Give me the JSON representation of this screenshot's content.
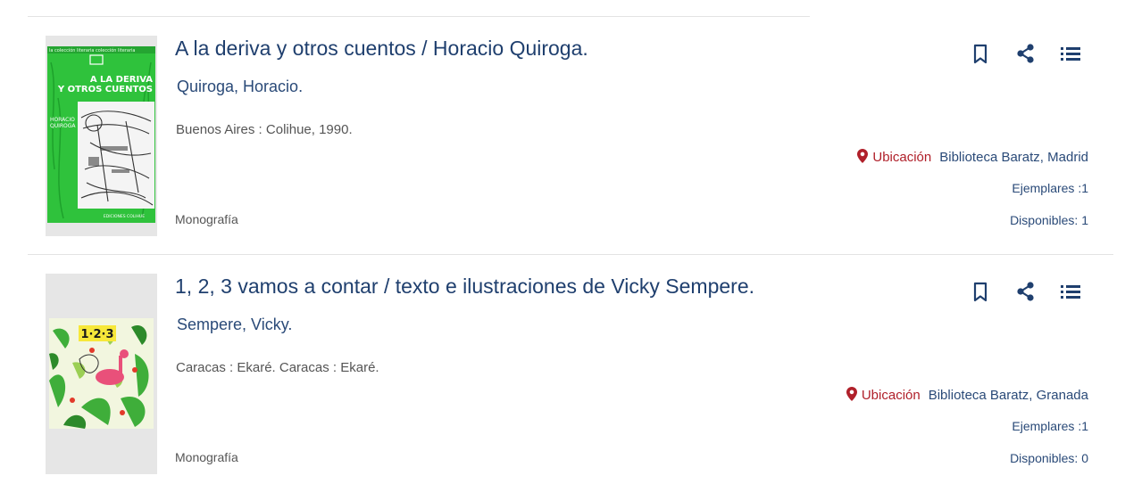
{
  "records": [
    {
      "title": "A la deriva y otros cuentos / Horacio Quiroga.",
      "author": "Quiroga, Horacio.",
      "publication": "Buenos Aires : Colihue, 1990.",
      "type": "Monografía",
      "location_label": "Ubicación",
      "library": "Biblioteca Baratz, Madrid",
      "copies": "Ejemplares :1",
      "available": "Disponibles: 1",
      "cover": {
        "series_band": "la colección literaria colección literaria",
        "title_line1": "A LA DERIVA",
        "title_line2": "Y OTROS CUENTOS",
        "author_line1": "HORACIO",
        "author_line2": "QUIROGA",
        "publisher": "EDICIONES COLIHUE",
        "background": "#2fc23c"
      }
    },
    {
      "title": "1, 2, 3 vamos a contar / texto e ilustraciones de Vicky Sempere.",
      "author": "Sempere, Vicky.",
      "publication": "Caracas : Ekaré. Caracas : Ekaré.",
      "type": "Monografía",
      "location_label": "Ubicación",
      "library": "Biblioteca Baratz, Granada",
      "copies": "Ejemplares :1",
      "available": "Disponibles: 0",
      "cover": {
        "title": "1·2·3",
        "background": "#f2f6df"
      }
    }
  ],
  "icons": {
    "bookmark": "bookmark-icon",
    "share": "share-icon",
    "list": "list-icon",
    "location": "map-pin-icon"
  },
  "colors": {
    "title": "#1f3f6e",
    "link": "#2a4a78",
    "location": "#b0202a",
    "text": "#555555"
  }
}
